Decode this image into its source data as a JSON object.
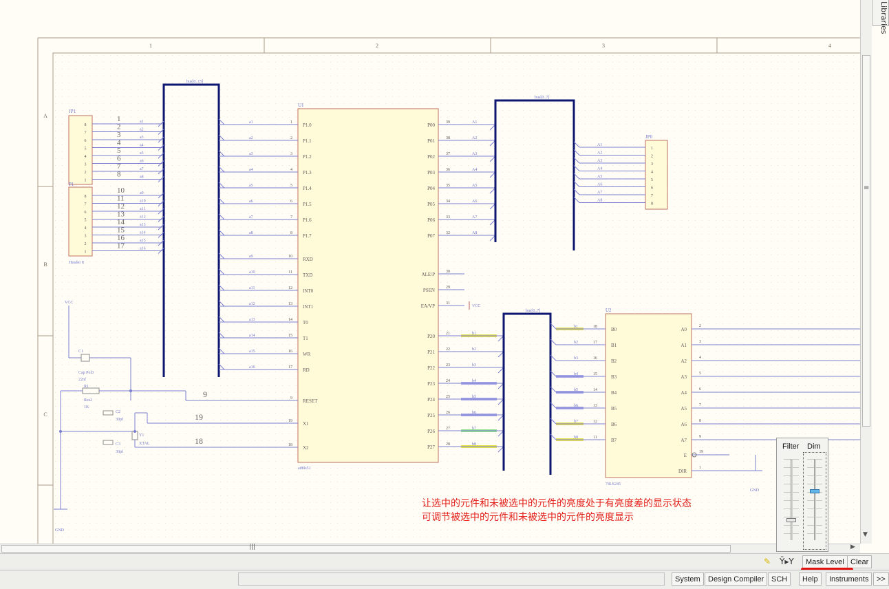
{
  "window": {
    "libraries_tab": "Libraries"
  },
  "sheet": {
    "columns": [
      "1",
      "2",
      "3",
      "4"
    ],
    "rows": [
      "A",
      "B",
      "C"
    ]
  },
  "annotation": {
    "line1": "让选中的元件和未被选中的元件的亮度处于有亮度差的显示状态",
    "line2": "可调节被选中的元件和未被选中的元件的亮度显示"
  },
  "dim_popup": {
    "filter_label": "Filter",
    "dim_label": "Dim",
    "filter_level": 0.25,
    "dim_level": 0.6
  },
  "mask_toolbar": {
    "mask_level_label": "Mask Level",
    "clear_label": "Clear"
  },
  "status_bar": {
    "panels": [
      "System",
      "Design Compiler",
      "SCH",
      "Help",
      "Instruments",
      ">>"
    ]
  },
  "schematic": {
    "jp1": {
      "ref": "JP1",
      "pins": [
        "8",
        "7",
        "6",
        "5",
        "4",
        "3",
        "2",
        "1"
      ]
    },
    "p1": {
      "ref": "P1",
      "name": "Header 8",
      "pins": [
        "8",
        "7",
        "6",
        "5",
        "4",
        "3",
        "2",
        "1"
      ]
    },
    "header_numbers": [
      "1",
      "2",
      "3",
      "4",
      "5",
      "6",
      "7",
      "8",
      "10",
      "11",
      "12",
      "13",
      "14",
      "15",
      "16",
      "17"
    ],
    "header_nets": [
      "a1",
      "a2",
      "a3",
      "a4",
      "a5",
      "a6",
      "a7",
      "a8",
      "a9",
      "a10",
      "a11",
      "a12",
      "a13",
      "a14",
      "a15",
      "a16"
    ],
    "bus1_label": "bus[0..15]",
    "bus2_label": "bus[0..7]",
    "bus3_label": "bus[0..7]",
    "u1": {
      "ref": "U1",
      "name": "at89s51",
      "left_pins": [
        {
          "name": "P1.0",
          "num": "1",
          "net": "a1"
        },
        {
          "name": "P1.1",
          "num": "2",
          "net": "a2"
        },
        {
          "name": "P1.2",
          "num": "3",
          "net": "a3"
        },
        {
          "name": "P1.3",
          "num": "4",
          "net": "a4"
        },
        {
          "name": "P1.4",
          "num": "5",
          "net": "a5"
        },
        {
          "name": "P1.5",
          "num": "6",
          "net": "a6"
        },
        {
          "name": "P1.6",
          "num": "7",
          "net": "a7"
        },
        {
          "name": "P1.7",
          "num": "8",
          "net": "a8"
        },
        {
          "name": "RXD",
          "num": "10",
          "net": "a9"
        },
        {
          "name": "TXD",
          "num": "11",
          "net": "a10"
        },
        {
          "name": "INT0",
          "num": "12",
          "net": "a11"
        },
        {
          "name": "INT1",
          "num": "13",
          "net": "a12"
        },
        {
          "name": "T0",
          "num": "14",
          "net": "a13"
        },
        {
          "name": "T1",
          "num": "15",
          "net": "a14"
        },
        {
          "name": "WR",
          "num": "16",
          "net": "a15"
        },
        {
          "name": "RD",
          "num": "17",
          "net": "a16"
        },
        {
          "name": "RESET",
          "num": "9",
          "net": ""
        },
        {
          "name": "X1",
          "num": "19",
          "net": ""
        },
        {
          "name": "X2",
          "num": "18",
          "net": ""
        }
      ],
      "right_pins_top": [
        {
          "name": "P00",
          "num": "39",
          "net": "A1"
        },
        {
          "name": "P01",
          "num": "38",
          "net": "A2"
        },
        {
          "name": "P02",
          "num": "37",
          "net": "A3"
        },
        {
          "name": "P03",
          "num": "36",
          "net": "A4"
        },
        {
          "name": "P04",
          "num": "35",
          "net": "A5"
        },
        {
          "name": "P05",
          "num": "34",
          "net": "A6"
        },
        {
          "name": "P06",
          "num": "33",
          "net": "A7"
        },
        {
          "name": "P07",
          "num": "32",
          "net": "A8"
        }
      ],
      "right_pins_mid": [
        {
          "name": "ALE/P",
          "num": "30"
        },
        {
          "name": "PSEN",
          "num": "29"
        },
        {
          "name": "EA/VP",
          "num": "31"
        }
      ],
      "right_pins_bottom": [
        {
          "name": "P20",
          "num": "21",
          "net": "b1"
        },
        {
          "name": "P21",
          "num": "22",
          "net": "b2"
        },
        {
          "name": "P22",
          "num": "23",
          "net": "b3"
        },
        {
          "name": "P23",
          "num": "24",
          "net": "b4"
        },
        {
          "name": "P24",
          "num": "25",
          "net": "b5"
        },
        {
          "name": "P25",
          "num": "26",
          "net": "b6"
        },
        {
          "name": "P26",
          "num": "27",
          "net": "b7"
        },
        {
          "name": "P27",
          "num": "28",
          "net": "b8"
        }
      ]
    },
    "vcc_label": "VCC",
    "gnd_label": "GND",
    "rc_numbers": [
      "9",
      "19",
      "18"
    ],
    "jp0": {
      "ref": "JP0",
      "pins": [
        "1",
        "2",
        "3",
        "4",
        "5",
        "6",
        "7",
        "8"
      ],
      "nets": [
        "A1",
        "A2",
        "A3",
        "A4",
        "A5",
        "A6",
        "A7",
        "A8"
      ]
    },
    "u2": {
      "ref": "U2",
      "name": "74LS245",
      "left_pins": [
        {
          "name": "B0",
          "num": "18",
          "net": "b1"
        },
        {
          "name": "B1",
          "num": "17",
          "net": "b2"
        },
        {
          "name": "B2",
          "num": "16",
          "net": "b3"
        },
        {
          "name": "B3",
          "num": "15",
          "net": "b4"
        },
        {
          "name": "B4",
          "num": "14",
          "net": "b5"
        },
        {
          "name": "B5",
          "num": "13",
          "net": "b6"
        },
        {
          "name": "B6",
          "num": "12",
          "net": "b7"
        },
        {
          "name": "B7",
          "num": "11",
          "net": "b8"
        }
      ],
      "right_pins": [
        {
          "name": "A0",
          "num": "2"
        },
        {
          "name": "A1",
          "num": "3"
        },
        {
          "name": "A2",
          "num": "4"
        },
        {
          "name": "A3",
          "num": "5"
        },
        {
          "name": "A4",
          "num": "6"
        },
        {
          "name": "A5",
          "num": "7"
        },
        {
          "name": "A6",
          "num": "8"
        },
        {
          "name": "A7",
          "num": "9"
        },
        {
          "name": "E",
          "num": "19"
        },
        {
          "name": "DIR",
          "num": "1"
        }
      ]
    },
    "components": {
      "c1": {
        "ref": "C1",
        "value": "Cap Pol3",
        "extra": "22nf"
      },
      "r1": {
        "ref": "R1",
        "value": "Res2",
        "extra": "1K"
      },
      "c2": {
        "ref": "C2",
        "value": "30pf"
      },
      "c3": {
        "ref": "C3",
        "value": "30pf"
      },
      "y1": {
        "ref": "Y1",
        "value": "XTAL"
      }
    },
    "colors": {
      "wire": "#7a7ed0",
      "bus": "#0d1670",
      "component_fill": "#fffbd8",
      "component_border": "#c17060",
      "highlight_yellow": "#e6e050",
      "highlight_blue": "#a6a6e8",
      "highlight_green": "#8ee08e",
      "annotation": "#e3201b"
    }
  }
}
